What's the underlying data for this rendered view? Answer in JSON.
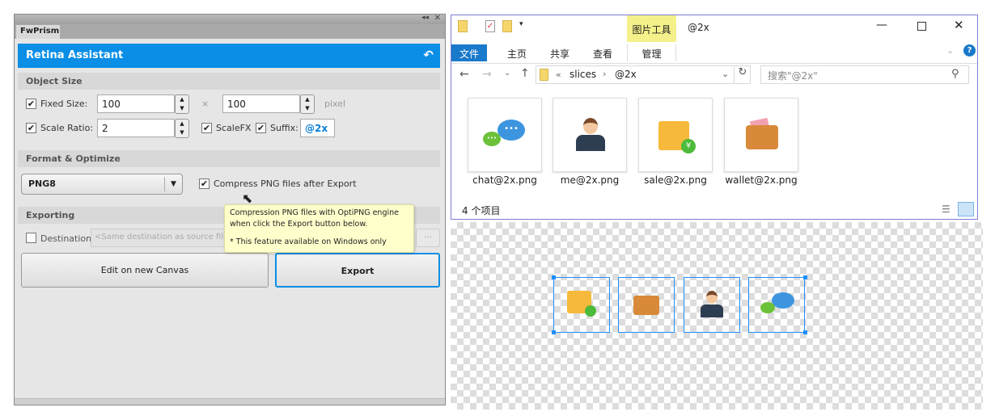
{
  "panel": {
    "tab": "FwPrism",
    "title": "Retina Assistant",
    "object_size": "Object Size",
    "fixed_size_label": "Fixed Size:",
    "width": "100",
    "height": "100",
    "times": "×",
    "unit": "pixel",
    "scale_ratio_label": "Scale Ratio:",
    "scale_ratio": "2",
    "scalefx_label": "ScaleFX",
    "suffix_label": "Suffix:",
    "suffix": "@2x",
    "format_section": "Format & Optimize",
    "format": "PNG8",
    "compress_label": "Compress PNG files after Export",
    "exporting": "Exporting",
    "destination_label": "Destination:",
    "destination_placeholder": "<Same destination as source file>",
    "browse": "...",
    "edit_btn": "Edit on new Canvas",
    "export_btn": "Export",
    "checks": {
      "fixed_size": true,
      "scale_ratio": true,
      "scalefx": true,
      "suffix": true,
      "compress": true,
      "destination": false
    }
  },
  "tooltip": {
    "line1": "Compression PNG files with OptiPNG engine",
    "line2": "when click the Export button below.",
    "line3": "* This feature available on Windows only"
  },
  "explorer": {
    "context_tab": "图片工具",
    "title": "@2x",
    "ribbon": [
      "文件",
      "主页",
      "共享",
      "查看",
      "管理"
    ],
    "breadcrumb_prefix": "«",
    "crumbs": [
      "slices",
      "@2x"
    ],
    "search_placeholder": "搜索\"@2x\"",
    "files": [
      "chat@2x.png",
      "me@2x.png",
      "sale@2x.png",
      "wallet@2x.png"
    ],
    "status": "4 个项目",
    "accent": "#1979ca"
  },
  "canvas": {
    "slices": [
      "sale",
      "wallet",
      "me",
      "chat"
    ]
  }
}
